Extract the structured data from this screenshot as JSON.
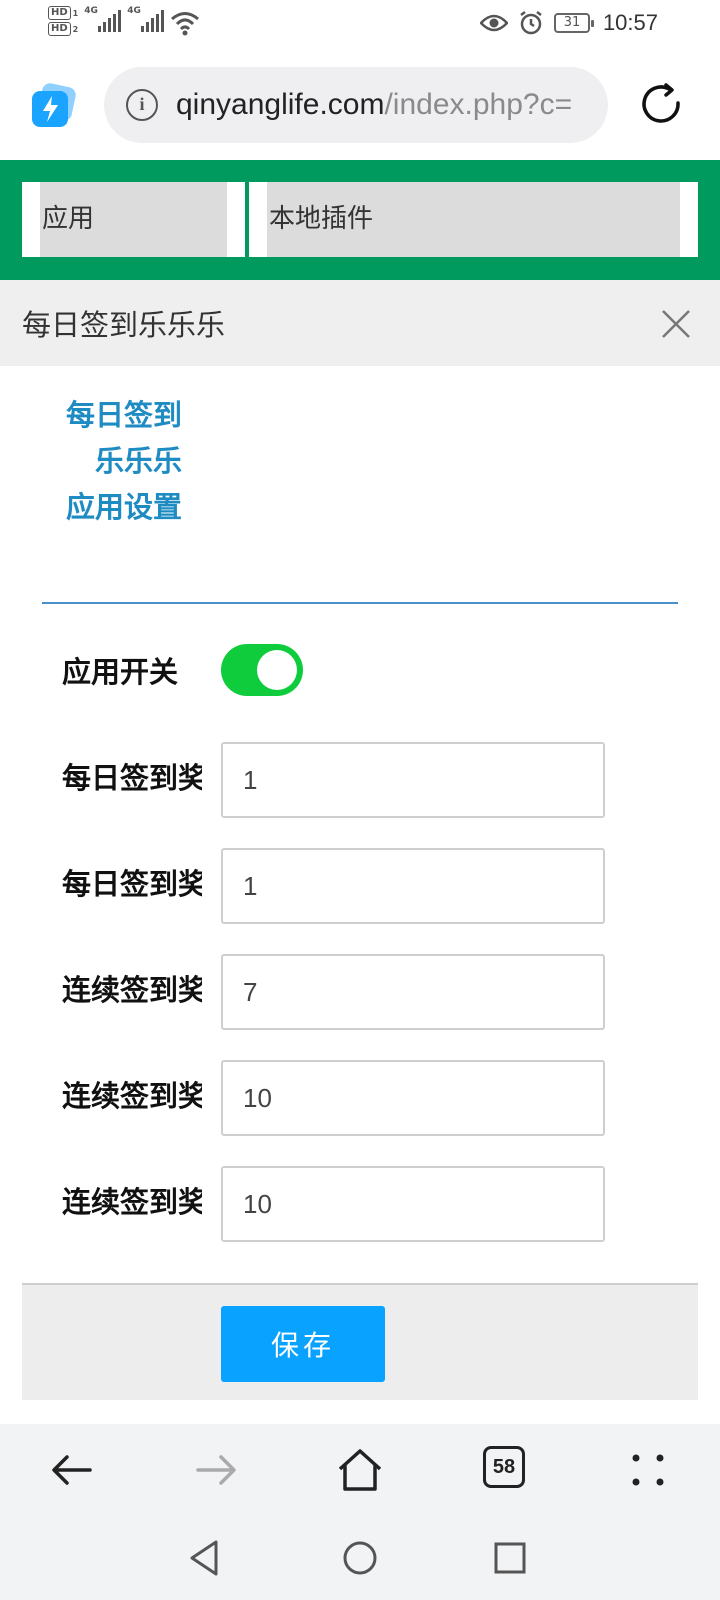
{
  "status_bar": {
    "hd1": "HD",
    "hd1_sub": "1",
    "hd2": "HD",
    "hd2_sub": "2",
    "net1": "4G",
    "net2": "4G",
    "battery": "31",
    "time": "10:57"
  },
  "browser": {
    "url_domain": "qinyanglife.com",
    "url_path": "/index.php?c=",
    "tab_count": "58",
    "icons": [
      "info-icon",
      "refresh-icon",
      "back-icon",
      "forward-icon",
      "home-icon",
      "menu-icon"
    ]
  },
  "nav": {
    "items": [
      {
        "label": "应用"
      },
      {
        "label": "本地插件"
      }
    ]
  },
  "dialog": {
    "title": "每日签到乐乐乐",
    "panel_title": "每日签到乐乐乐 应用设置",
    "form": {
      "toggle_label": "应用开关",
      "toggle_on": true,
      "fields": [
        {
          "label": "每日签到奖",
          "value": "1"
        },
        {
          "label": "每日签到奖",
          "value": "1"
        },
        {
          "label": "连续签到奖",
          "value": "7"
        },
        {
          "label": "连续签到奖",
          "value": "10"
        },
        {
          "label": "连续签到奖",
          "value": "10"
        }
      ]
    },
    "save_label": "保存"
  },
  "colors": {
    "nav_green": "#009a5e",
    "title_blue": "#1e8bc3",
    "toggle_green": "#0fcc3c",
    "save_blue": "#0aa2ff"
  }
}
